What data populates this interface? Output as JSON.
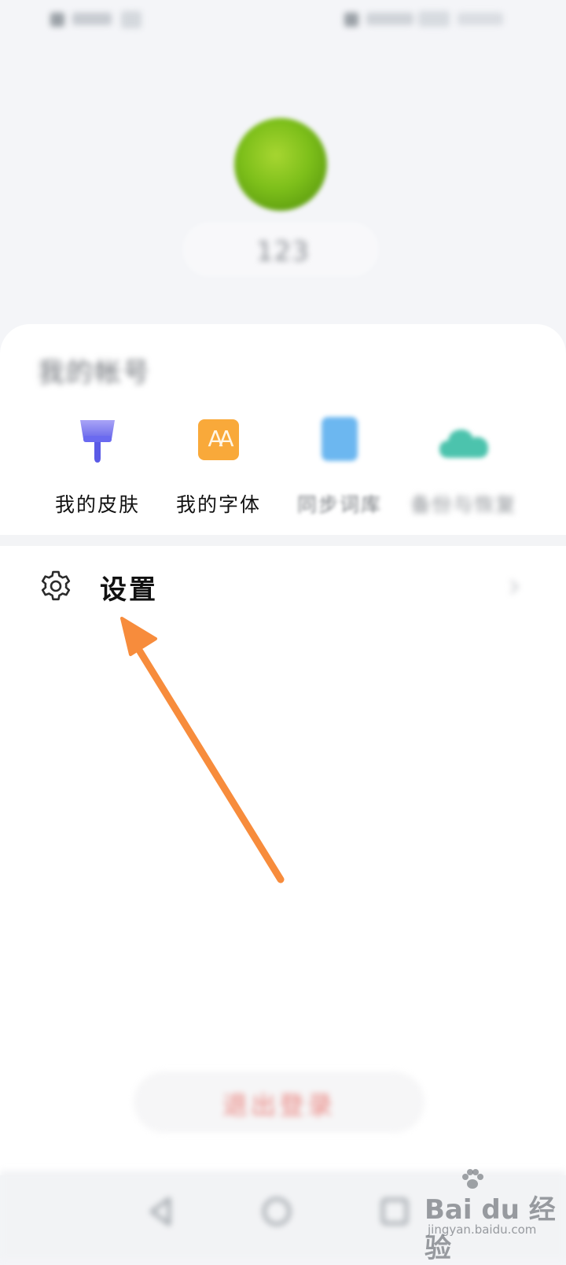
{
  "profile": {
    "username": "123"
  },
  "account": {
    "title": "我的帐号",
    "features": [
      {
        "label": "我的皮肤",
        "icon": "paint-brush-icon"
      },
      {
        "label": "我的字体",
        "icon": "font-aa-icon"
      },
      {
        "label": "同步词库",
        "icon": "sync-book-icon"
      },
      {
        "label": "备份与恢复",
        "icon": "cloud-icon"
      }
    ]
  },
  "settings": {
    "label": "设置",
    "icon": "gear-icon"
  },
  "logout": {
    "label": "退出登录"
  },
  "watermark": {
    "brand": "Bai du 经验",
    "url": "jingyan.baidu.com"
  },
  "colors": {
    "annotation_arrow": "#f78c3c",
    "font_icon": "#f9a93a",
    "brush_icon": "#6a6af0",
    "sync_icon": "#6cb7f0",
    "cloud_icon": "#4cc3ad",
    "logout_text": "#e9837e"
  }
}
